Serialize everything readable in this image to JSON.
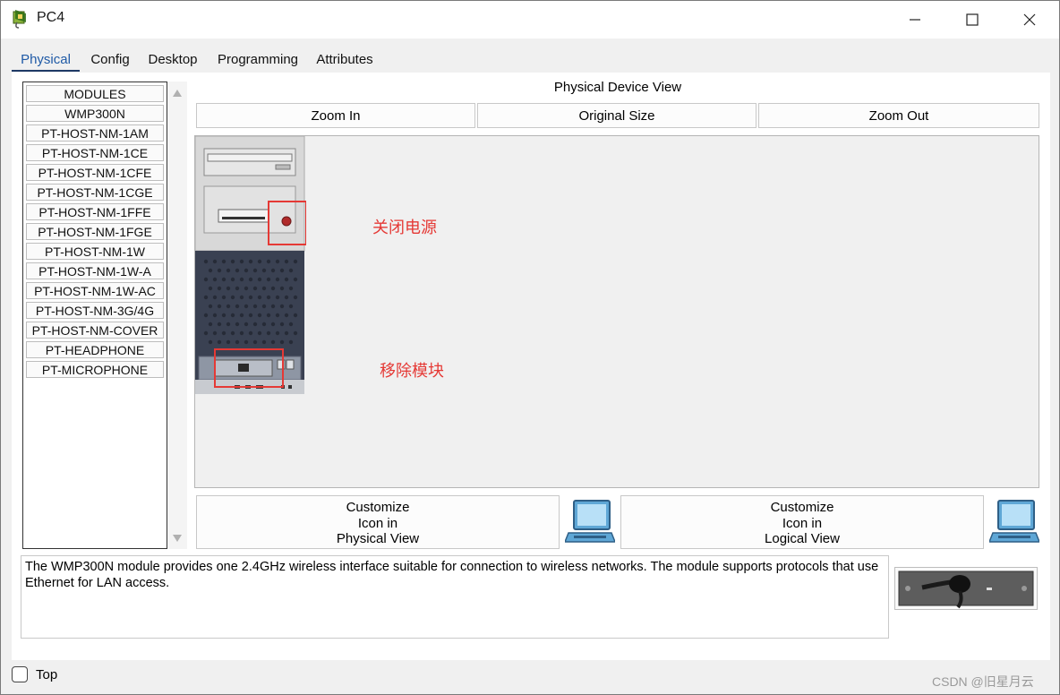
{
  "window": {
    "title": "PC4",
    "icon": "pc-icon",
    "controls": {
      "minimize": "minimize-icon",
      "maximize": "maximize-icon",
      "close": "close-icon"
    }
  },
  "tabs": [
    {
      "label": "Physical",
      "active": true
    },
    {
      "label": "Config",
      "active": false
    },
    {
      "label": "Desktop",
      "active": false
    },
    {
      "label": "Programming",
      "active": false
    },
    {
      "label": "Attributes",
      "active": false
    }
  ],
  "modules": {
    "header": "MODULES",
    "items": [
      "WMP300N",
      "PT-HOST-NM-1AM",
      "PT-HOST-NM-1CE",
      "PT-HOST-NM-1CFE",
      "PT-HOST-NM-1CGE",
      "PT-HOST-NM-1FFE",
      "PT-HOST-NM-1FGE",
      "PT-HOST-NM-1W",
      "PT-HOST-NM-1W-A",
      "PT-HOST-NM-1W-AC",
      "PT-HOST-NM-3G/4G",
      "PT-HOST-NM-COVER",
      "PT-HEADPHONE",
      "PT-MICROPHONE"
    ]
  },
  "physical_view": {
    "title": "Physical Device View",
    "zoom_in": "Zoom In",
    "original_size": "Original Size",
    "zoom_out": "Zoom Out",
    "annotation_power": "关闭电源",
    "annotation_module": "移除模块",
    "annotation_color": "#e53935"
  },
  "customize": {
    "physical": {
      "line1": "Customize",
      "line2": "Icon in",
      "line3": "Physical View"
    },
    "logical": {
      "line1": "Customize",
      "line2": "Icon in",
      "line3": "Logical View"
    }
  },
  "description": "The WMP300N module provides one 2.4GHz wireless interface suitable for connection to wireless networks. The module supports protocols that use Ethernet for LAN access.",
  "footer": {
    "top_label": "Top",
    "top_checked": false
  },
  "watermark": "CSDN @旧星月云"
}
